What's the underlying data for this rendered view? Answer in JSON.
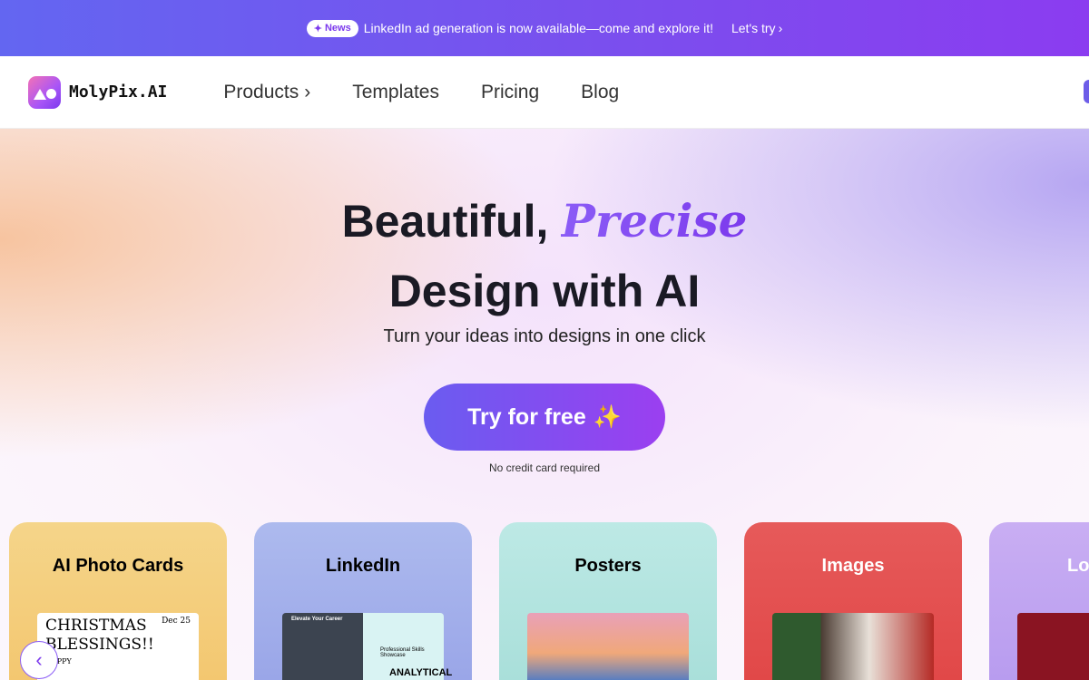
{
  "banner": {
    "badge": "News",
    "message": "LinkedIn ad generation is now available—come and explore it!",
    "cta": "Let's try"
  },
  "nav": {
    "logo": "MolyPix.AI",
    "items": [
      "Products",
      "Templates",
      "Pricing",
      "Blog"
    ]
  },
  "hero": {
    "title_1": "Beautiful,",
    "title_accent": "Precise",
    "title_2": "Design with AI",
    "subtitle": "Turn your ideas into designs in one click",
    "cta": "Try for free",
    "note": "No credit card required"
  },
  "cards": [
    {
      "title": "AI Photo Cards",
      "bg": "#f5d58a",
      "color": "#111"
    },
    {
      "title": "LinkedIn",
      "bg": "#a9b4ec",
      "color": "#111"
    },
    {
      "title": "Posters",
      "bg": "#b6e6e2",
      "color": "#111"
    },
    {
      "title": "Images",
      "bg": "#e5514f",
      "color": "#fff"
    },
    {
      "title": "Lo",
      "bg": "#c5a9f2",
      "color": "#fff"
    }
  ],
  "card_previews": {
    "christmas_title": "CHRISTMAS BLESSINGS!!",
    "christmas_date": "Dec 25",
    "christmas_sub": "HAPPY",
    "linkedin_head": "Elevate Your Career",
    "linkedin_mid": "Professional Skills Showcase",
    "linkedin_big": "ANALYTICAL"
  }
}
